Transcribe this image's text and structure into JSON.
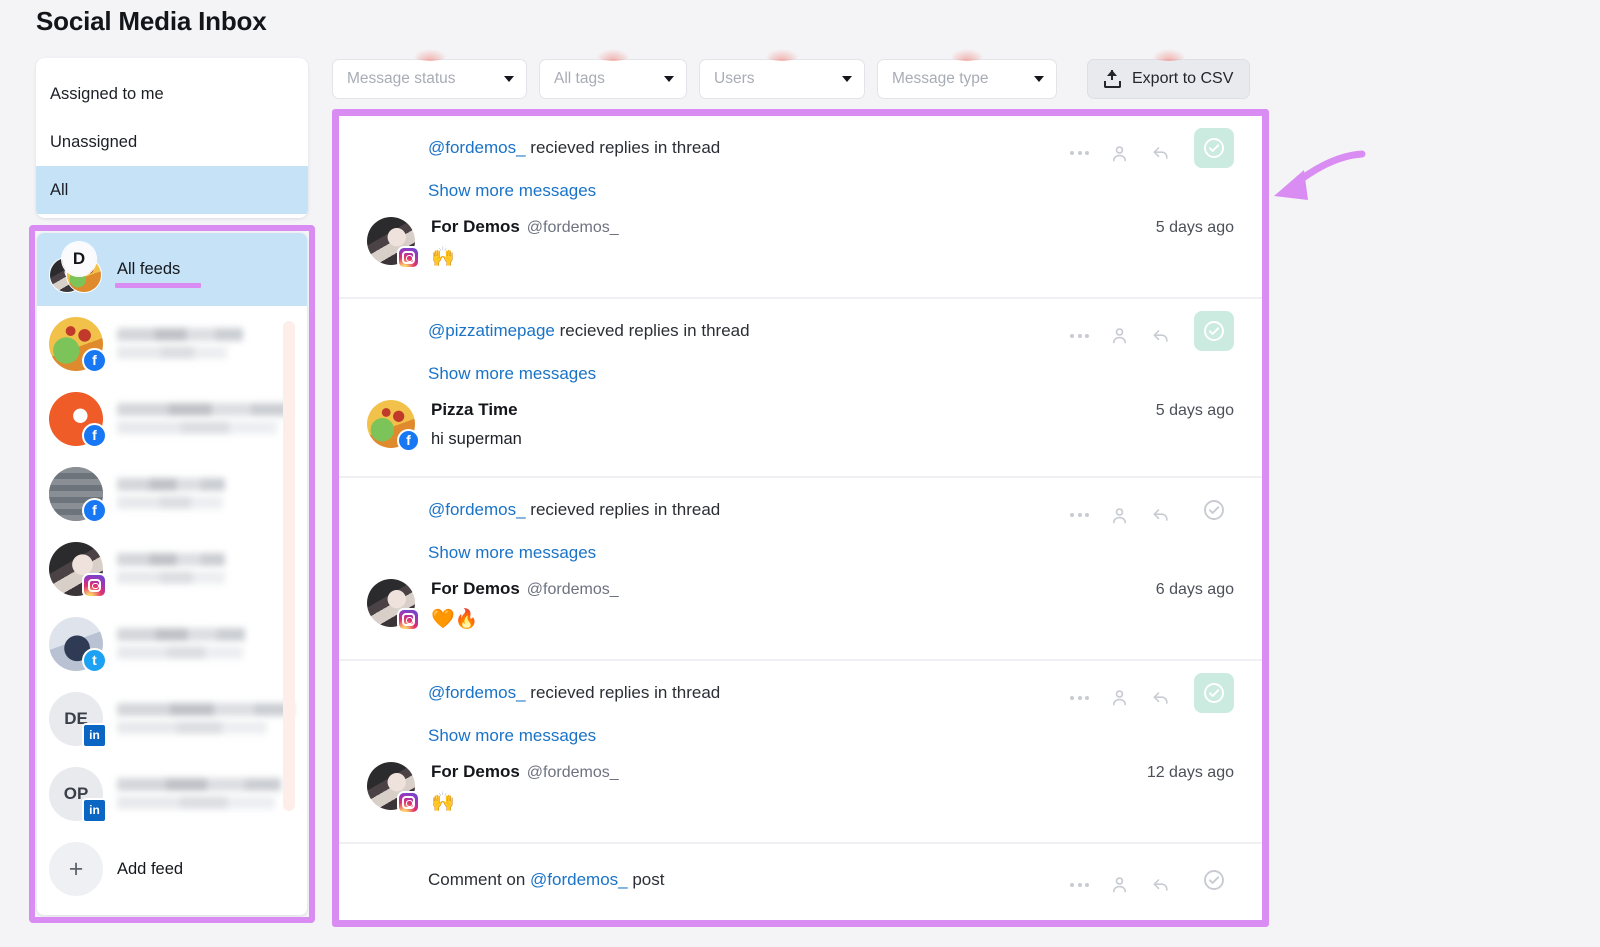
{
  "header": {
    "title": "Social Media Inbox"
  },
  "assignment_filter": {
    "items": [
      {
        "label": "Assigned to me",
        "selected": false
      },
      {
        "label": "Unassigned",
        "selected": false
      },
      {
        "label": "All",
        "selected": true
      }
    ]
  },
  "feeds": {
    "all_feeds_label": "All feeds",
    "add_feed_label": "Add feed",
    "items": [
      {
        "name": "",
        "platform": "facebook",
        "avatar": "pizza",
        "redacted": true
      },
      {
        "name": "",
        "platform": "facebook",
        "avatar": "orange",
        "redacted": true
      },
      {
        "name": "",
        "platform": "facebook",
        "avatar": "socialmedia",
        "redacted": true
      },
      {
        "name": "",
        "platform": "instagram",
        "avatar": "girl",
        "redacted": true
      },
      {
        "name": "",
        "platform": "twitter",
        "avatar": "twitterav",
        "redacted": true
      },
      {
        "name": "",
        "platform": "linkedin",
        "avatar": "initials",
        "initials": "DE",
        "redacted": true
      },
      {
        "name": "",
        "platform": "linkedin",
        "avatar": "initials",
        "initials": "OP",
        "redacted": true
      }
    ]
  },
  "filters": [
    {
      "label": "Message status",
      "width_class": "w1"
    },
    {
      "label": "All tags",
      "width_class": "w2"
    },
    {
      "label": "Users",
      "width_class": "w3"
    },
    {
      "label": "Message type",
      "width_class": "w4"
    }
  ],
  "export": {
    "label": "Export to CSV"
  },
  "messages": {
    "show_more_label": "Show more messages",
    "thread_suffix": " recieved replies in thread",
    "items": [
      {
        "handle": "@fordemos_",
        "title_suffix": " recieved replies in thread",
        "show_more": "Show more messages",
        "author_name": "For Demos",
        "author_handle": "@fordemos_",
        "time": "5 days ago",
        "text": "🙌",
        "platform": "instagram",
        "avatar": "girl",
        "resolved": true
      },
      {
        "handle": "@pizzatimepage",
        "title_suffix": " recieved replies in thread",
        "show_more": "Show more messages",
        "author_name": "Pizza Time",
        "author_handle": "",
        "time": "5 days ago",
        "text": "hi superman",
        "platform": "facebook",
        "avatar": "pizza",
        "resolved": true
      },
      {
        "handle": "@fordemos_",
        "title_suffix": " recieved replies in thread",
        "show_more": "Show more messages",
        "author_name": "For Demos",
        "author_handle": "@fordemos_",
        "time": "6 days ago",
        "text": "🧡🔥",
        "platform": "instagram",
        "avatar": "girl",
        "resolved": false
      },
      {
        "handle": "@fordemos_",
        "title_suffix": " recieved replies in thread",
        "show_more": "Show more messages",
        "author_name": "For Demos",
        "author_handle": "@fordemos_",
        "time": "12 days ago",
        "text": "🙌",
        "platform": "instagram",
        "avatar": "girl",
        "resolved": true
      }
    ],
    "cut_off_item": {
      "prefix": "Comment on ",
      "handle": "@fordemos_",
      "suffix": " post"
    }
  },
  "annotations": {
    "highlight_color": "#d98cf2",
    "arrow": "left-pointing-curved-arrow",
    "underline_target": "All feeds"
  }
}
